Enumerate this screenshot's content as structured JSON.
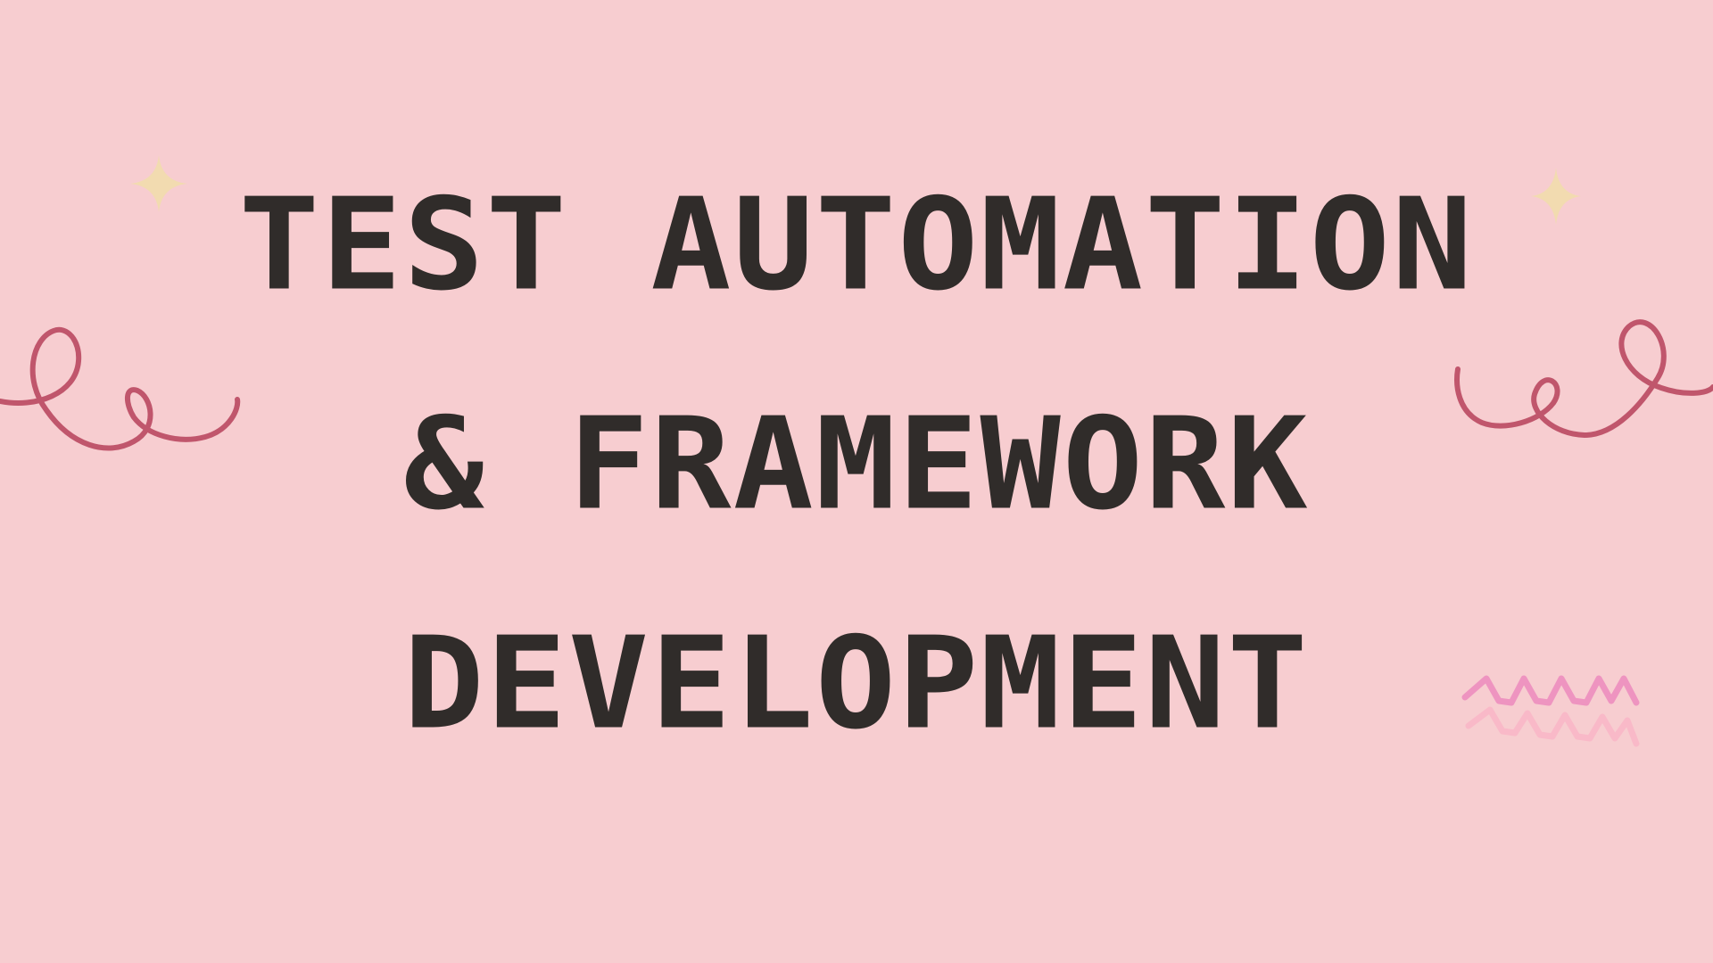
{
  "title": {
    "line1": "TEST AUTOMATION",
    "line2": "& FRAMEWORK",
    "line3": "DEVELOPMENT"
  },
  "colors": {
    "background": "#f7cdd0",
    "text": "#302c2a",
    "swirl": "#c0566c",
    "sparkle": "#f2dbb0",
    "zigzag_top": "#ee94c0",
    "zigzag_bottom": "#f9b9c8"
  },
  "decorations": [
    "sparkle-icon",
    "swirl-icon",
    "zigzag-icon"
  ]
}
